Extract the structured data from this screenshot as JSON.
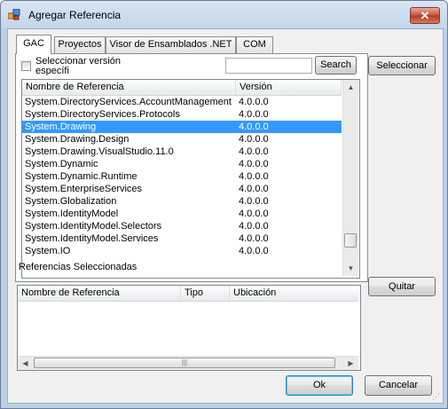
{
  "window": {
    "title": "Agregar Referencia",
    "close_glyph": "✕"
  },
  "tabs": [
    {
      "label": "GAC"
    },
    {
      "label": "Proyectos"
    },
    {
      "label": "Visor de Ensamblados .NET"
    },
    {
      "label": "COM"
    }
  ],
  "gac": {
    "specific_version_label": "Seleccionar versión específi",
    "specific_version_checked": false,
    "search_value": "",
    "search_button": "Search",
    "columns": [
      "Nombre de Referencia",
      "Versión"
    ],
    "rows": [
      {
        "name": "System.DirectoryServices.AccountManagement",
        "version": "4.0.0.0",
        "selected": false
      },
      {
        "name": "System.DirectoryServices.Protocols",
        "version": "4.0.0.0",
        "selected": false
      },
      {
        "name": "System.Drawing",
        "version": "4.0.0.0",
        "selected": true
      },
      {
        "name": "System.Drawing.Design",
        "version": "4.0.0.0",
        "selected": false
      },
      {
        "name": "System.Drawing.VisualStudio.11.0",
        "version": "4.0.0.0",
        "selected": false
      },
      {
        "name": "System.Dynamic",
        "version": "4.0.0.0",
        "selected": false
      },
      {
        "name": "System.Dynamic.Runtime",
        "version": "4.0.0.0",
        "selected": false
      },
      {
        "name": "System.EnterpriseServices",
        "version": "4.0.0.0",
        "selected": false
      },
      {
        "name": "System.Globalization",
        "version": "4.0.0.0",
        "selected": false
      },
      {
        "name": "System.IdentityModel",
        "version": "4.0.0.0",
        "selected": false
      },
      {
        "name": "System.IdentityModel.Selectors",
        "version": "4.0.0.0",
        "selected": false
      },
      {
        "name": "System.IdentityModel.Services",
        "version": "4.0.0.0",
        "selected": false
      },
      {
        "name": "System.IO",
        "version": "4.0.0.0",
        "selected": false
      }
    ]
  },
  "selected_refs": {
    "title": "Referencias Seleccionadas",
    "columns": [
      "Nombre de Referencia",
      "Tipo",
      "Ubicación"
    ],
    "rows": []
  },
  "buttons": {
    "select": "Seleccionar",
    "remove": "Quitar",
    "ok": "Ok",
    "cancel": "Cancelar"
  },
  "colors": {
    "selection": "#3399ff",
    "chrome": "#c4d6ea"
  }
}
